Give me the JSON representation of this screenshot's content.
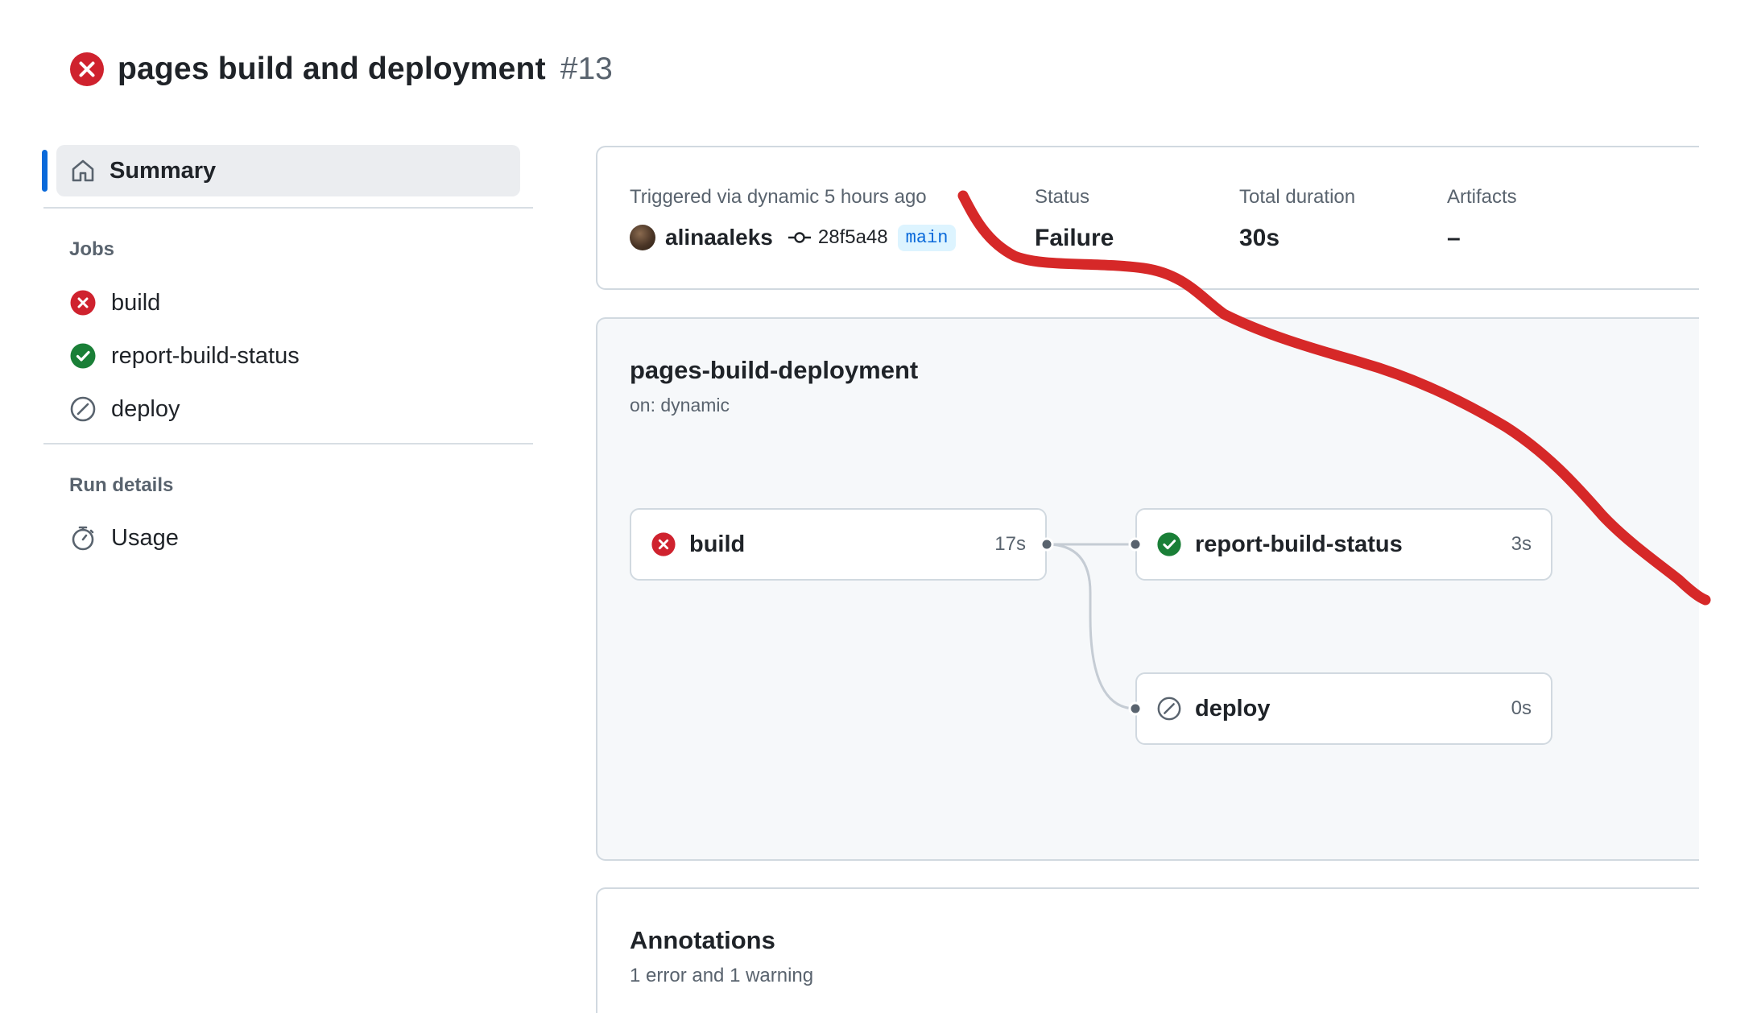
{
  "run": {
    "title": "pages build and deployment",
    "number": "#13",
    "status_color": "#cf222e"
  },
  "sidebar": {
    "summary_label": "Summary",
    "jobs_heading": "Jobs",
    "jobs": [
      {
        "label": "build",
        "status": "failure",
        "icon": "x-circle-icon"
      },
      {
        "label": "report-build-status",
        "status": "success",
        "icon": "check-circle-icon"
      },
      {
        "label": "deploy",
        "status": "skipped",
        "icon": "skipped-icon"
      }
    ],
    "run_details_heading": "Run details",
    "usage_label": "Usage"
  },
  "summary": {
    "triggered_text": "Triggered via dynamic 5 hours ago",
    "author": "alinaaleks",
    "commit_sha": "28f5a48",
    "branch": "main",
    "status_label": "Status",
    "status_value": "Failure",
    "duration_label": "Total duration",
    "duration_value": "30s",
    "artifacts_label": "Artifacts",
    "artifacts_value": "–"
  },
  "workflow": {
    "name": "pages-build-deployment",
    "trigger": "on: dynamic",
    "jobs": [
      {
        "name": "build",
        "duration": "17s",
        "status": "failure"
      },
      {
        "name": "report-build-status",
        "duration": "3s",
        "status": "success"
      },
      {
        "name": "deploy",
        "duration": "0s",
        "status": "skipped"
      }
    ]
  },
  "annotations": {
    "title": "Annotations",
    "summary": "1 error and 1 warning"
  },
  "colors": {
    "failure": "#cf222e",
    "success": "#1a7f37",
    "accent": "#0969da",
    "muted": "#59636e",
    "scribble": "#d62828"
  }
}
